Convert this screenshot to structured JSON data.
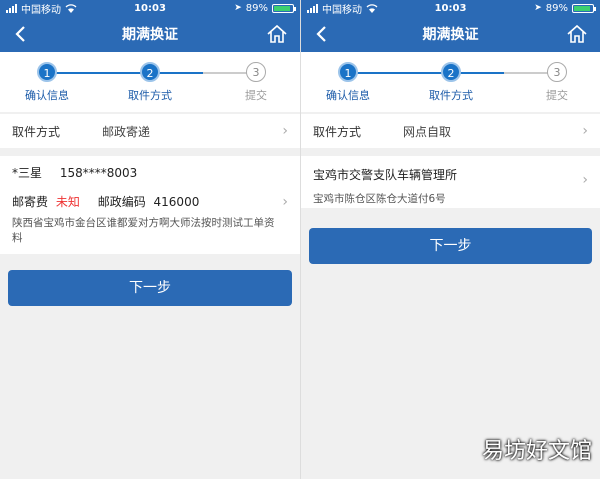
{
  "status": {
    "carrier": "中国移动",
    "time": "10:03",
    "battery": "89%",
    "battery_level": 0.89
  },
  "title": "期满换证",
  "steps": [
    "确认信息",
    "取件方式",
    "提交"
  ],
  "step_numbers": [
    "1",
    "2",
    "3"
  ],
  "left": {
    "pick_label": "取件方式",
    "pick_value": "邮政寄递",
    "name": "*三星",
    "phone": "158****8003",
    "postage_label": "邮寄费",
    "postage_value": "未知",
    "postcode_label": "邮政编码",
    "postcode_value": "416000",
    "address": "陕西省宝鸡市金台区谁都爱对方啊大师法按时测试工单资料",
    "next": "下一步"
  },
  "right": {
    "pick_label": "取件方式",
    "pick_value": "网点自取",
    "point_name": "宝鸡市交警支队车辆管理所",
    "point_address": "宝鸡市陈仓区陈仓大道付6号",
    "next": "下一步"
  },
  "icons": {
    "back": "back-arrow-icon",
    "home": "home-icon",
    "chevron": "chevron-right-icon"
  },
  "colors": {
    "brand": "#2b6ab5",
    "step_active": "#1a73c7",
    "warning": "#e33"
  },
  "watermark": "易坊好文馆"
}
